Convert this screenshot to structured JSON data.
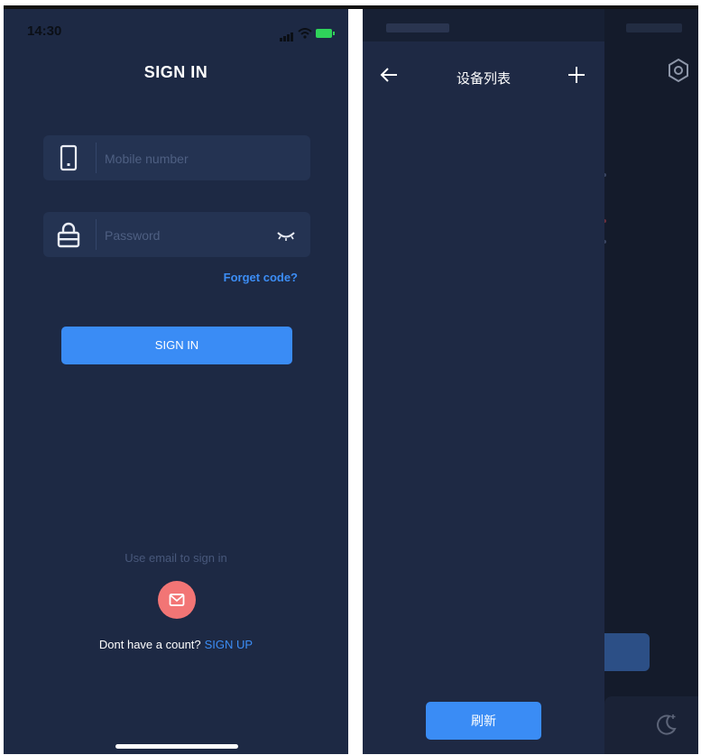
{
  "signin": {
    "status_time": "14:30",
    "title": "SIGN IN",
    "mobile_placeholder": "Mobile number",
    "password_placeholder": "Password",
    "forget_code": "Forget code?",
    "signin_button": "SIGN IN",
    "use_email_text": "Use email to sign in",
    "no_account_text": "Dont have a count?",
    "signup_link": "SIGN UP"
  },
  "device_drawer": {
    "title": "设备列表",
    "refresh_button": "刷新"
  },
  "colors": {
    "background": "#1d2944",
    "field": "#243352",
    "accent": "#3a8cf5",
    "email_button": "#f27575"
  },
  "icons": {
    "mobile": "phone-icon",
    "password": "lock-icon",
    "eye": "eye-closed-icon",
    "email": "mail-icon",
    "back": "arrow-left-icon",
    "add": "plus-icon",
    "settings": "gear-icon",
    "night": "moon-icon"
  }
}
